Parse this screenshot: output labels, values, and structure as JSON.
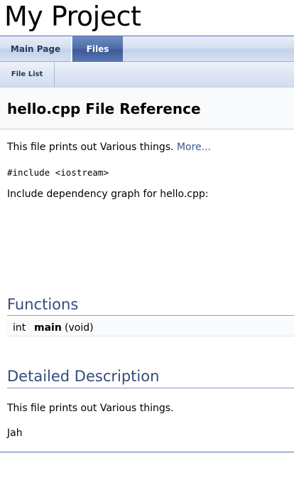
{
  "project": {
    "title": "My Project"
  },
  "tabs": [
    {
      "label": "Main Page",
      "active": false
    },
    {
      "label": "Files",
      "active": true
    }
  ],
  "subtabs": [
    {
      "label": "File List"
    }
  ],
  "header": {
    "title": "hello.cpp File Reference"
  },
  "brief": {
    "text": "This file prints out Various things. ",
    "more_label": "More..."
  },
  "includes": [
    "#include <iostream>"
  ],
  "dependency_graph": {
    "label": "Include dependency graph for hello.cpp:"
  },
  "functions_section": {
    "title": "Functions",
    "rows": [
      {
        "type": "int",
        "name": "main",
        "args": "(void)"
      }
    ]
  },
  "detailed_section": {
    "title": "Detailed Description",
    "paragraphs": [
      "This file prints out Various things.",
      "Jah"
    ]
  },
  "colors": {
    "accent": "#354c7b",
    "link": "#3d578c",
    "active_tab": "#4f6daa"
  }
}
